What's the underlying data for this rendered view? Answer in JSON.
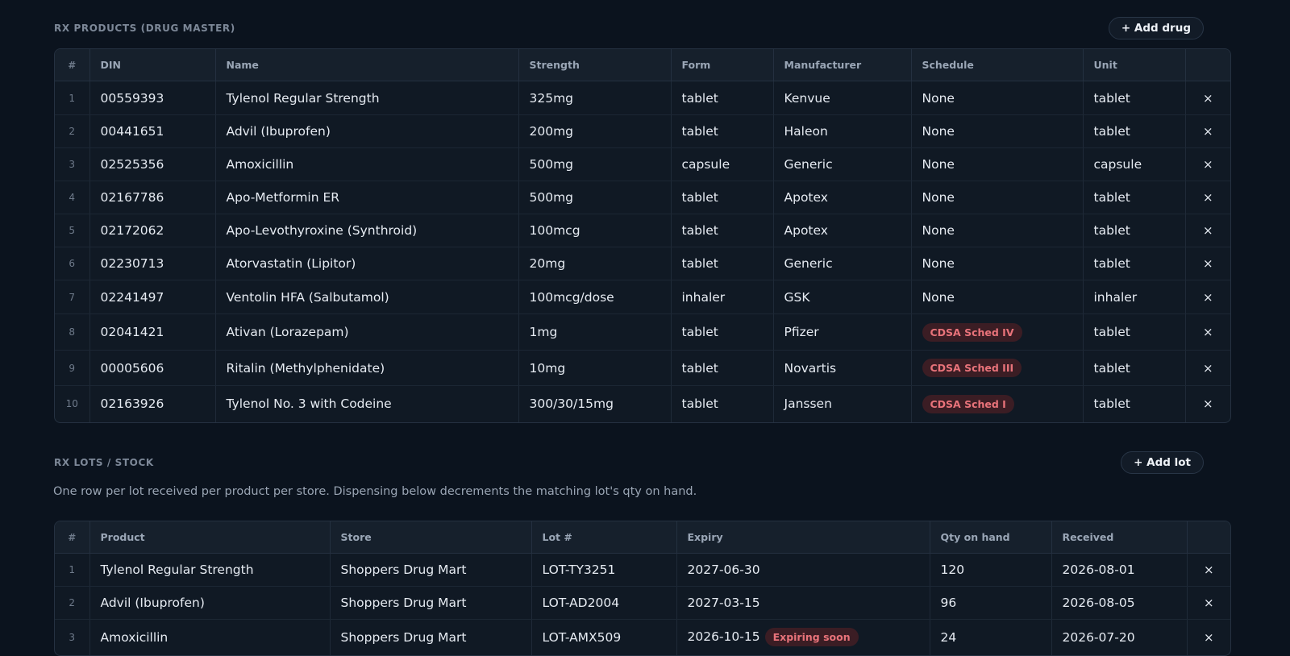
{
  "products": {
    "title": "RX PRODUCTS (DRUG MASTER)",
    "add_label": "+ Add drug",
    "columns": [
      "#",
      "DIN",
      "Name",
      "Strength",
      "Form",
      "Manufacturer",
      "Schedule",
      "Unit",
      ""
    ],
    "rows": [
      {
        "n": "1",
        "din": "00559393",
        "name": "Tylenol Regular Strength",
        "strength": "325mg",
        "form": "tablet",
        "mfr": "Kenvue",
        "schedule": "None",
        "unit": "tablet"
      },
      {
        "n": "2",
        "din": "00441651",
        "name": "Advil (Ibuprofen)",
        "strength": "200mg",
        "form": "tablet",
        "mfr": "Haleon",
        "schedule": "None",
        "unit": "tablet"
      },
      {
        "n": "3",
        "din": "02525356",
        "name": "Amoxicillin",
        "strength": "500mg",
        "form": "capsule",
        "mfr": "Generic",
        "schedule": "None",
        "unit": "capsule"
      },
      {
        "n": "4",
        "din": "02167786",
        "name": "Apo-Metformin ER",
        "strength": "500mg",
        "form": "tablet",
        "mfr": "Apotex",
        "schedule": "None",
        "unit": "tablet"
      },
      {
        "n": "5",
        "din": "02172062",
        "name": "Apo-Levothyroxine (Synthroid)",
        "strength": "100mcg",
        "form": "tablet",
        "mfr": "Apotex",
        "schedule": "None",
        "unit": "tablet"
      },
      {
        "n": "6",
        "din": "02230713",
        "name": "Atorvastatin (Lipitor)",
        "strength": "20mg",
        "form": "tablet",
        "mfr": "Generic",
        "schedule": "None",
        "unit": "tablet"
      },
      {
        "n": "7",
        "din": "02241497",
        "name": "Ventolin HFA (Salbutamol)",
        "strength": "100mcg/dose",
        "form": "inhaler",
        "mfr": "GSK",
        "schedule": "None",
        "unit": "inhaler"
      },
      {
        "n": "8",
        "din": "02041421",
        "name": "Ativan (Lorazepam)",
        "strength": "1mg",
        "form": "tablet",
        "mfr": "Pfizer",
        "schedule": "CDSA Sched IV",
        "unit": "tablet"
      },
      {
        "n": "9",
        "din": "00005606",
        "name": "Ritalin (Methylphenidate)",
        "strength": "10mg",
        "form": "tablet",
        "mfr": "Novartis",
        "schedule": "CDSA Sched III",
        "unit": "tablet"
      },
      {
        "n": "10",
        "din": "02163926",
        "name": "Tylenol No. 3 with Codeine",
        "strength": "300/30/15mg",
        "form": "tablet",
        "mfr": "Janssen",
        "schedule": "CDSA Sched I",
        "unit": "tablet"
      }
    ]
  },
  "lots": {
    "title": "RX LOTS / STOCK",
    "add_label": "+ Add lot",
    "description": "One row per lot received per product per store. Dispensing below decrements the matching lot's qty on hand.",
    "columns": [
      "#",
      "Product",
      "Store",
      "Lot #",
      "Expiry",
      "Qty on hand",
      "Received",
      ""
    ],
    "rows": [
      {
        "n": "1",
        "product": "Tylenol Regular Strength",
        "store": "Shoppers Drug Mart",
        "lot": "LOT-TY3251",
        "expiry": "2027-06-30",
        "badge": "",
        "qty": "120",
        "received": "2026-08-01"
      },
      {
        "n": "2",
        "product": "Advil (Ibuprofen)",
        "store": "Shoppers Drug Mart",
        "lot": "LOT-AD2004",
        "expiry": "2027-03-15",
        "badge": "",
        "qty": "96",
        "received": "2026-08-05"
      },
      {
        "n": "3",
        "product": "Amoxicillin",
        "store": "Shoppers Drug Mart",
        "lot": "LOT-AMX509",
        "expiry": "2026-10-15",
        "badge": "Expiring soon",
        "qty": "24",
        "received": "2026-07-20"
      }
    ]
  },
  "remove_symbol": "×",
  "colors": {
    "background": "#0b131e",
    "badge_bg": "#3b1d24",
    "badge_text": "#e8737a"
  }
}
